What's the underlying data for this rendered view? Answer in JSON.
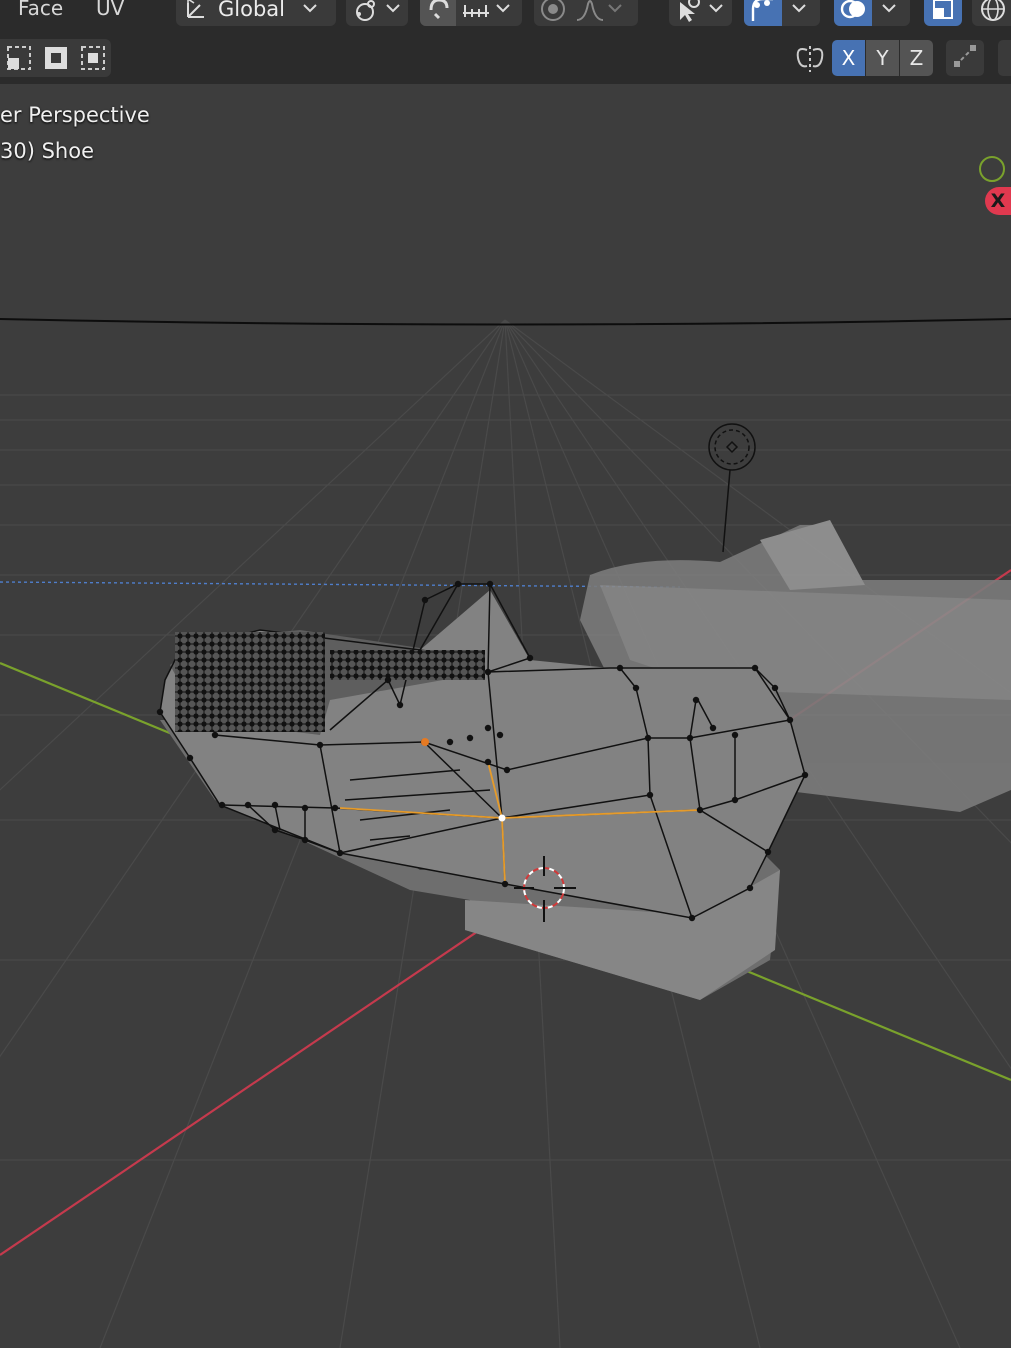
{
  "header": {
    "menu": [
      {
        "label": "Face"
      },
      {
        "label": "UV"
      }
    ],
    "orientation": {
      "label": "Global",
      "icon": "transform-orientation-icon"
    },
    "pivot_icon": "pivot-point-icon",
    "snap_icon": "snap-magnet-icon",
    "snap_target_icon": "snap-increment-icon",
    "proportional_icon": "proportional-editing-icon",
    "falloff_icon": "falloff-curve-icon",
    "select_icon": "selectability-visibility-icon",
    "gizmo_icon": "gizmo-icon",
    "overlay_icon": "overlays-icon",
    "xray_icon": "toggle-xray-icon",
    "shading_icon": "wireframe-shading-icon"
  },
  "toolbar": {
    "selection_modes": [
      "select-new-icon",
      "select-extend-icon",
      "select-subtract-icon"
    ],
    "mirror_icon": "mirror-butterfly-icon",
    "axes": [
      {
        "label": "X",
        "active": true
      },
      {
        "label": "Y",
        "active": false
      },
      {
        "label": "Z",
        "active": false
      }
    ],
    "autoscale_icon": "auto-merge-icon"
  },
  "viewport": {
    "view_name": "er Perspective",
    "object_info": "30) Shoe",
    "nav_gizmo_x": "X"
  },
  "colors": {
    "header_bg": "#2b2b2b",
    "viewport_bg": "#3d3d3d",
    "accent": "#4772b3",
    "axis_x": "#e0394f",
    "axis_y": "#7aa22c",
    "selection": "#e69b2a"
  }
}
